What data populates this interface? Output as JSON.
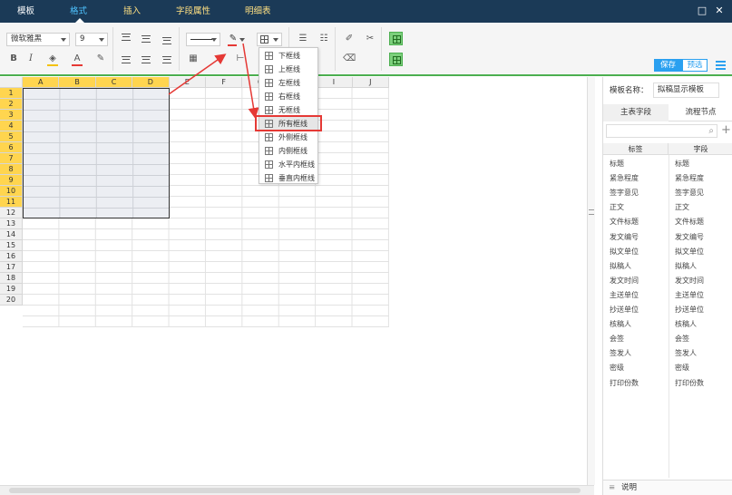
{
  "menubar": {
    "items": [
      "模板",
      "格式",
      "插入",
      "字段属性",
      "明细表"
    ],
    "window": {
      "maximize": "□",
      "close": "✕"
    }
  },
  "toolbar": {
    "font_family": "微软雅黑",
    "font_size": "9",
    "bold": "B",
    "italic": "I",
    "save_label": "保存",
    "preview_label": "预选"
  },
  "sheet": {
    "columns": [
      "A",
      "B",
      "C",
      "D",
      "E",
      "F",
      "G",
      "H",
      "I",
      "J"
    ],
    "rows": [
      "1",
      "2",
      "3",
      "4",
      "5",
      "6",
      "7",
      "8",
      "9",
      "10",
      "11",
      "12",
      "13",
      "14",
      "15",
      "16",
      "17",
      "18",
      "19",
      "20"
    ]
  },
  "border_menu": {
    "options": [
      "下框线",
      "上框线",
      "左框线",
      "右框线",
      "无框线",
      "所有框线",
      "外侧框线",
      "内侧框线",
      "水平内框线",
      "垂直内框线"
    ],
    "highlighted": "所有框线"
  },
  "panel": {
    "template_name_label": "模板名称：",
    "template_name_value": "拟稿显示模板",
    "tabs": [
      "主表字段",
      "流程节点"
    ],
    "search_icon_label": "⌕",
    "add_label": "+",
    "columns": [
      "标签",
      "字段"
    ],
    "fields": [
      [
        "标题",
        "标题"
      ],
      [
        "紧急程度",
        "紧急程度"
      ],
      [
        "签字意见",
        "签字意见"
      ],
      [
        "正文",
        "正文"
      ],
      [
        "文件标题",
        "文件标题"
      ],
      [
        "发文编号",
        "发文编号"
      ],
      [
        "拟文单位",
        "拟文单位"
      ],
      [
        "拟稿人",
        "拟稿人"
      ],
      [
        "发文时间",
        "发文时间"
      ],
      [
        "主送单位",
        "主送单位"
      ],
      [
        "抄送单位",
        "抄送单位"
      ],
      [
        "核稿人",
        "核稿人"
      ],
      [
        "会签",
        "会签"
      ],
      [
        "签发人",
        "签发人"
      ],
      [
        "密级",
        "密级"
      ],
      [
        "打印份数",
        "打印份数"
      ]
    ],
    "notes_label": "说明"
  }
}
